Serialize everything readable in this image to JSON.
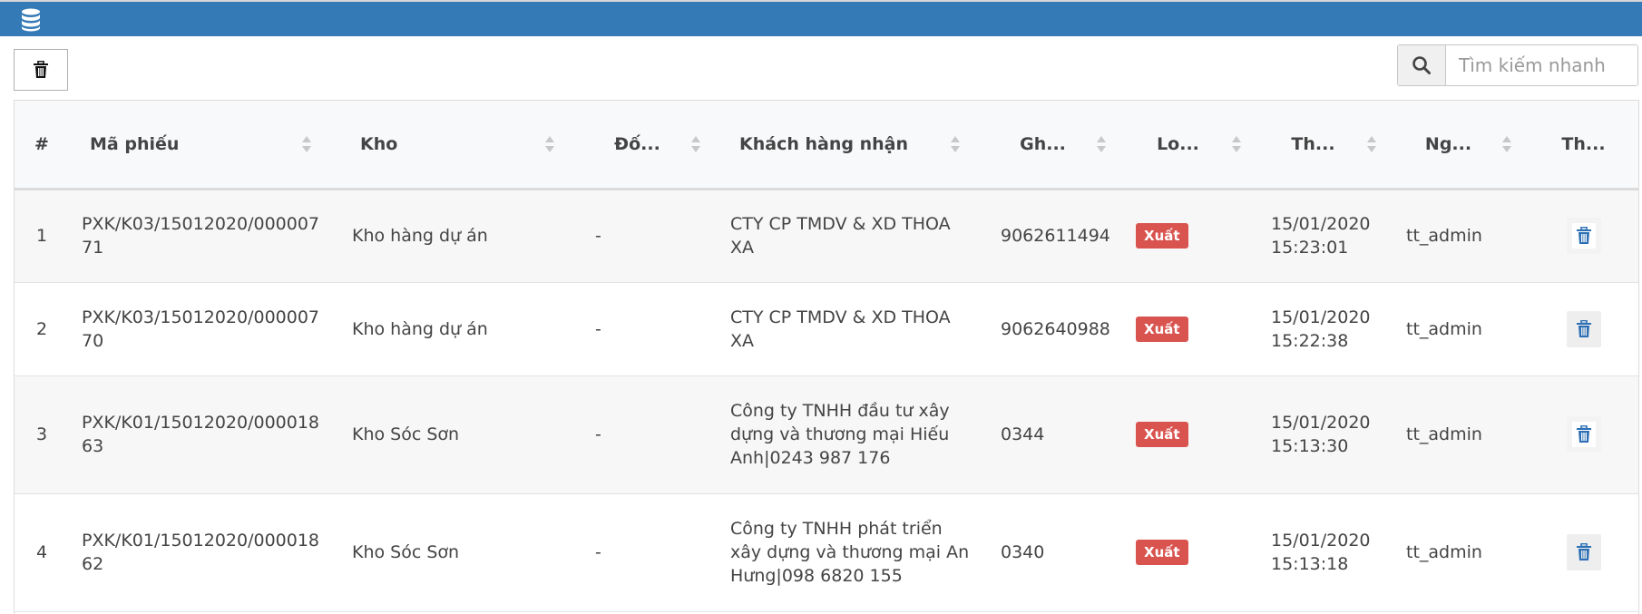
{
  "icons": {
    "topbar": "database-icon",
    "toolbar_delete": "trash-icon",
    "search": "search-icon",
    "row_delete": "trash-icon",
    "sort": "sort-icon"
  },
  "colors": {
    "topbar": "#337ab7",
    "badge_export": "#d9534f",
    "row_delete_icon": "#2c6fb5"
  },
  "search": {
    "placeholder": "Tìm kiếm nhanh",
    "value": ""
  },
  "table": {
    "columns": [
      "#",
      "Mã phiếu",
      "Kho",
      "Đố...",
      "Khách hàng nhận",
      "Gh...",
      "Lo...",
      "Th...",
      "Ng...",
      "Th..."
    ],
    "rows": [
      {
        "index": "1",
        "code": "PXK/K03/15012020/00000771",
        "warehouse": "Kho hàng dự án",
        "partner": "-",
        "customer": "CTY CP TMDV & XD THOA XA",
        "note": "9062611494",
        "type": "Xuất",
        "time": "15/01/2020 15:23:01",
        "user": "tt_admin"
      },
      {
        "index": "2",
        "code": "PXK/K03/15012020/00000770",
        "warehouse": "Kho hàng dự án",
        "partner": "-",
        "customer": "CTY CP TMDV & XD THOA XA",
        "note": "9062640988",
        "type": "Xuất",
        "time": "15/01/2020 15:22:38",
        "user": "tt_admin"
      },
      {
        "index": "3",
        "code": "PXK/K01/15012020/00001863",
        "warehouse": "Kho Sóc Sơn",
        "partner": "-",
        "customer": "Công ty TNHH đầu tư xây dựng và thương mại Hiếu Anh|0243 987 176",
        "note": "0344",
        "type": "Xuất",
        "time": "15/01/2020 15:13:30",
        "user": "tt_admin"
      },
      {
        "index": "4",
        "code": "PXK/K01/15012020/00001862",
        "warehouse": "Kho Sóc Sơn",
        "partner": "-",
        "customer": "Công ty TNHH phát triển xây dựng và thương mại An Hưng|098 6820 155",
        "note": "0340",
        "type": "Xuất",
        "time": "15/01/2020 15:13:18",
        "user": "tt_admin"
      }
    ]
  }
}
